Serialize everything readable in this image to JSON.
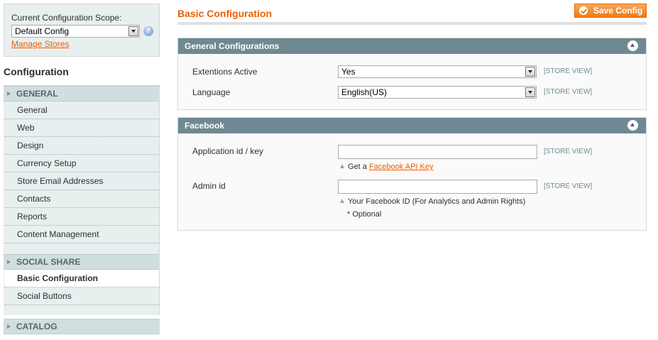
{
  "scope": {
    "label": "Current Configuration Scope:",
    "value": "Default Config",
    "manage_link": "Manage Stores"
  },
  "sidebar": {
    "title": "Configuration",
    "sections": [
      {
        "title": "GENERAL",
        "items": [
          "General",
          "Web",
          "Design",
          "Currency Setup",
          "Store Email Addresses",
          "Contacts",
          "Reports",
          "Content Management"
        ]
      },
      {
        "title": "SOCIAL SHARE",
        "items": [
          "Basic Configuration",
          "Social Buttons"
        ],
        "active_item": "Basic Configuration"
      },
      {
        "title": "CATALOG",
        "items": []
      }
    ]
  },
  "page": {
    "title": "Basic Configuration",
    "save_label": "Save Config"
  },
  "general_fieldset": {
    "title": "General Configurations",
    "fields": [
      {
        "label": "Extentions Active",
        "value": "Yes",
        "scope": "[STORE VIEW]"
      },
      {
        "label": "Language",
        "value": "English(US)",
        "scope": "[STORE VIEW]"
      }
    ]
  },
  "facebook_fieldset": {
    "title": "Facebook",
    "app_id": {
      "label": "Application id / key",
      "value": "",
      "scope": "[STORE VIEW]",
      "note_prefix": "Get a",
      "note_link": "Facebook API Key"
    },
    "admin_id": {
      "label": "Admin id",
      "value": "",
      "scope": "[STORE VIEW]",
      "note": "Your Facebook ID (For Analytics and Admin Rights)",
      "note2": "* Optional"
    }
  }
}
